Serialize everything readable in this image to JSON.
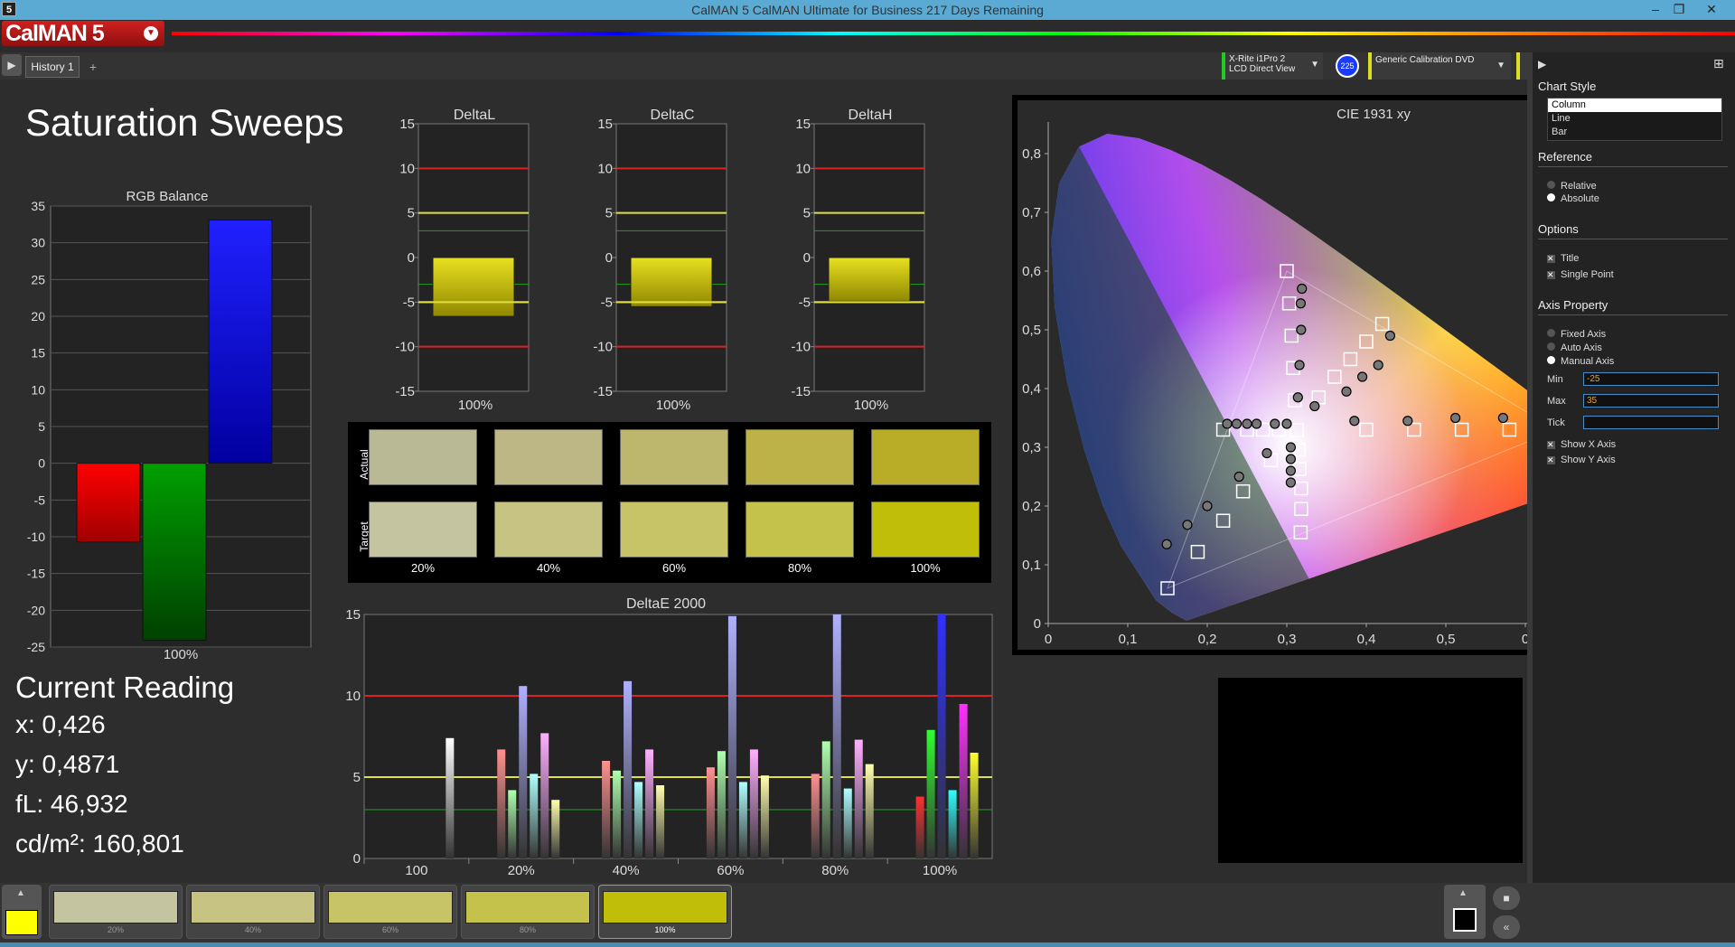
{
  "window": {
    "title": "CalMAN 5 CalMAN Ultimate for Business 217 Days Remaining",
    "app_icon": "5"
  },
  "brand": {
    "logo": "CalMAN 5"
  },
  "tabs": [
    {
      "label": "History 1"
    }
  ],
  "devices": {
    "meter_line1": "X-Rite i1Pro 2",
    "meter_line2": "LCD Direct View",
    "badge": "225",
    "source": "Generic Calibration DVD"
  },
  "page": {
    "title": "Saturation Sweeps"
  },
  "rgb_balance": {
    "title": "RGB Balance",
    "ylim": [
      -25,
      35
    ],
    "ticks": [
      "35",
      "30",
      "25",
      "20",
      "15",
      "10",
      "5",
      "0",
      "-5",
      "-10",
      "-15",
      "-20",
      "-25"
    ],
    "category": "100%",
    "values": [
      {
        "name": "R",
        "value": -10.7,
        "color": "#ff0000"
      },
      {
        "name": "G",
        "value": -24.1,
        "color": "#00a000"
      },
      {
        "name": "B",
        "value": 33.1,
        "color": "#2020ff"
      }
    ]
  },
  "delta_charts": [
    {
      "title": "DeltaL",
      "value": -6.6,
      "category": "100%"
    },
    {
      "title": "DeltaC",
      "value": -5.5,
      "category": "100%"
    },
    {
      "title": "DeltaH",
      "value": -4.9,
      "category": "100%"
    }
  ],
  "delta_ticks": [
    "15",
    "10",
    "5",
    "0",
    "-5",
    "-10",
    "-15"
  ],
  "swatches": {
    "row_labels": [
      "Actual",
      "Target"
    ],
    "labels": [
      "20%",
      "40%",
      "60%",
      "80%",
      "100%"
    ],
    "actual": [
      "#b9b995",
      "#bcb784",
      "#bdb66d",
      "#bcb248",
      "#b9ad28"
    ],
    "target": [
      "#c4c4a0",
      "#c6c383",
      "#c7c367",
      "#c5c24c",
      "#c0be08"
    ]
  },
  "deltae": {
    "title": "DeltaE 2000",
    "ylim": [
      0,
      15
    ],
    "ticks": [
      "15",
      "10",
      "5",
      "0"
    ],
    "groups": [
      "100",
      "20%",
      "40%",
      "60%",
      "80%",
      "100%"
    ],
    "series_colors": [
      "#ffffff",
      "#ff6060",
      "#60ff60",
      "#8080ff",
      "#60ffff",
      "#ff60ff",
      "#ffff60"
    ],
    "values": [
      [
        7.4
      ],
      [
        6.7,
        4.2,
        10.6,
        5.2,
        7.7,
        3.6
      ],
      [
        6.0,
        5.4,
        10.9,
        4.7,
        6.7,
        4.5
      ],
      [
        5.6,
        6.6,
        14.9,
        4.7,
        6.7,
        5.1
      ],
      [
        5.2,
        7.2,
        15.0,
        4.3,
        7.3,
        5.8
      ],
      [
        3.8,
        7.9,
        15.0,
        4.2,
        9.5,
        6.5
      ]
    ]
  },
  "cie": {
    "title": "CIE 1931 xy",
    "x_ticks": [
      "0",
      "0,1",
      "0,2",
      "0,3",
      "0,4",
      "0,5",
      "0"
    ],
    "y_ticks": [
      "0,8",
      "0,7",
      "0,6",
      "0,5",
      "0,4",
      "0,3",
      "0,2",
      "0,1",
      "0"
    ],
    "targets": [
      [
        0.3127,
        0.329
      ],
      [
        0.3,
        0.6
      ],
      [
        0.303,
        0.545
      ],
      [
        0.306,
        0.49
      ],
      [
        0.308,
        0.435
      ],
      [
        0.31,
        0.38
      ],
      [
        0.42,
        0.51
      ],
      [
        0.4,
        0.48
      ],
      [
        0.38,
        0.45
      ],
      [
        0.36,
        0.42
      ],
      [
        0.34,
        0.385
      ],
      [
        0.22,
        0.33
      ],
      [
        0.25,
        0.33
      ],
      [
        0.27,
        0.33
      ],
      [
        0.29,
        0.33
      ],
      [
        0.15,
        0.06
      ],
      [
        0.188,
        0.122
      ],
      [
        0.22,
        0.175
      ],
      [
        0.245,
        0.225
      ],
      [
        0.28,
        0.278
      ],
      [
        0.64,
        0.33
      ],
      [
        0.58,
        0.33
      ],
      [
        0.52,
        0.33
      ],
      [
        0.46,
        0.33
      ],
      [
        0.4,
        0.33
      ],
      [
        0.3175,
        0.155
      ],
      [
        0.318,
        0.195
      ],
      [
        0.318,
        0.23
      ],
      [
        0.316,
        0.263
      ],
      [
        0.315,
        0.296
      ]
    ],
    "measured": [
      [
        0.3175,
        0.545
      ],
      [
        0.319,
        0.57
      ],
      [
        0.318,
        0.5
      ],
      [
        0.316,
        0.44
      ],
      [
        0.314,
        0.385
      ],
      [
        0.43,
        0.49
      ],
      [
        0.415,
        0.44
      ],
      [
        0.395,
        0.42
      ],
      [
        0.375,
        0.395
      ],
      [
        0.335,
        0.37
      ],
      [
        0.225,
        0.34
      ],
      [
        0.237,
        0.34
      ],
      [
        0.25,
        0.34
      ],
      [
        0.262,
        0.34
      ],
      [
        0.285,
        0.34
      ],
      [
        0.3,
        0.34
      ],
      [
        0.149,
        0.135
      ],
      [
        0.175,
        0.168
      ],
      [
        0.2,
        0.2
      ],
      [
        0.24,
        0.25
      ],
      [
        0.275,
        0.29
      ],
      [
        0.632,
        0.35
      ],
      [
        0.572,
        0.35
      ],
      [
        0.512,
        0.35
      ],
      [
        0.452,
        0.345
      ],
      [
        0.385,
        0.345
      ],
      [
        0.305,
        0.24
      ],
      [
        0.305,
        0.26
      ],
      [
        0.305,
        0.28
      ],
      [
        0.305,
        0.3
      ]
    ]
  },
  "current_reading": {
    "title": "Current Reading",
    "x": "x: 0,426",
    "y": "y: 0,4871",
    "fl": "fL: 46,932",
    "cdm2": "cd/m²: 160,801"
  },
  "side_panel": {
    "chart_style_label": "Chart Style",
    "chart_styles": [
      "Column",
      "Line",
      "Bar"
    ],
    "selected_style": "Column",
    "reference_label": "Reference",
    "reference_options": [
      "Relative",
      "Absolute"
    ],
    "reference_selected": "Absolute",
    "options_label": "Options",
    "options": [
      {
        "label": "Title",
        "checked": true
      },
      {
        "label": "Single Point",
        "checked": true
      }
    ],
    "axis_property_label": "Axis Property",
    "axis_options": [
      "Fixed Axis",
      "Auto Axis",
      "Manual Axis"
    ],
    "axis_selected": "Manual Axis",
    "min_label": "Min",
    "min_value": "-25",
    "max_label": "Max",
    "max_value": "35",
    "tick_label": "Tick",
    "tick_value": "",
    "show_x_axis": "Show X Axis",
    "show_y_axis": "Show Y Axis"
  },
  "bottom_swatches": {
    "labels": [
      "20%",
      "40%",
      "60%",
      "80%",
      "100%"
    ],
    "colors": [
      "#c4c4a0",
      "#c6c383",
      "#c7c367",
      "#c5c24c",
      "#c0be08"
    ],
    "current_color": "#ffff00"
  }
}
